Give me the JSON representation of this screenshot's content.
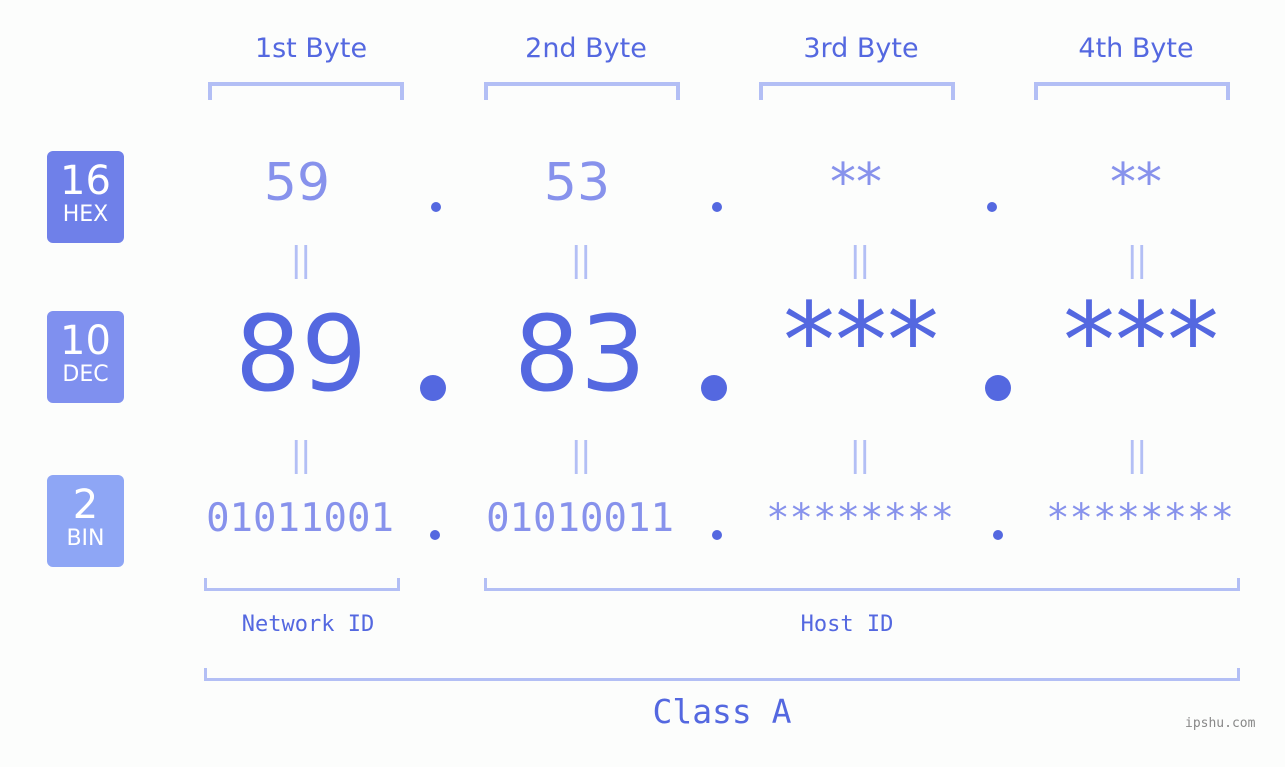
{
  "bytes": [
    {
      "header": "1st Byte",
      "hex": "59",
      "dec": "89",
      "bin": "01011001"
    },
    {
      "header": "2nd Byte",
      "hex": "53",
      "dec": "83",
      "bin": "01010011"
    },
    {
      "header": "3rd Byte",
      "hex": "**",
      "dec": "***",
      "bin": "********"
    },
    {
      "header": "4th Byte",
      "hex": "**",
      "dec": "***",
      "bin": "********"
    }
  ],
  "badges": {
    "hex": {
      "number": "16",
      "label": "HEX",
      "color": "#6f80e9"
    },
    "dec": {
      "number": "10",
      "label": "DEC",
      "color": "#7f90ef"
    },
    "bin": {
      "number": "2",
      "label": "BIN",
      "color": "#8ea6f5"
    }
  },
  "equals": "=",
  "labels": {
    "network": "Network ID",
    "host": "Host ID",
    "class": "Class A"
  },
  "watermark": "ipshu.com"
}
